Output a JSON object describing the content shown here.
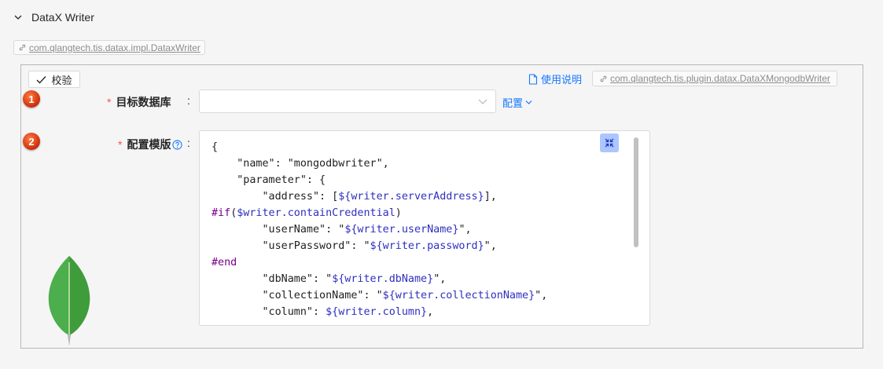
{
  "section": {
    "title": "DataX Writer"
  },
  "impl_tag": {
    "label": "com.qlangtech.tis.datax.impl.DataxWriter"
  },
  "plugin_tag": {
    "label": "com.qlangtech.tis.plugin.datax.DataXMongodbWriter"
  },
  "toolbar": {
    "verify_label": "校验",
    "usage_label": "使用说明"
  },
  "steps": [
    "1",
    "2"
  ],
  "fields": {
    "target_db": {
      "label": "目标数据库",
      "required_mark": "*",
      "colon": ":",
      "value": "",
      "config_label": "配置"
    },
    "template": {
      "label": "配置模版",
      "required_mark": "*",
      "colon": ":"
    }
  },
  "editor": {
    "lines": [
      "{",
      "    \"name\": \"mongodbwriter\",",
      "    \"parameter\": {",
      "        \"address\": [${writer.serverAddress}],",
      "#if($writer.containCredential)",
      "        \"userName\": \"${writer.userName}\",",
      "        \"userPassword\": \"${writer.password}\",",
      "#end",
      "        \"dbName\": \"${writer.dbName}\",",
      "        \"collectionName\": \"${writer.collectionName}\",",
      "        \"column\": ${writer.column},"
    ]
  },
  "colors": {
    "link": "#1677ff",
    "required": "#ff4d4f",
    "badge": "#d4380d",
    "expand_button": "#adc6ff",
    "template_var": "#2f2fbf",
    "directive": "#770088"
  },
  "icons": {
    "collapse": "chevron-down-icon",
    "link": "link-icon",
    "check": "check-icon",
    "doc": "document-icon",
    "help": "question-circle-icon",
    "expand": "compress-icon",
    "logo": "mongodb-leaf-icon"
  }
}
